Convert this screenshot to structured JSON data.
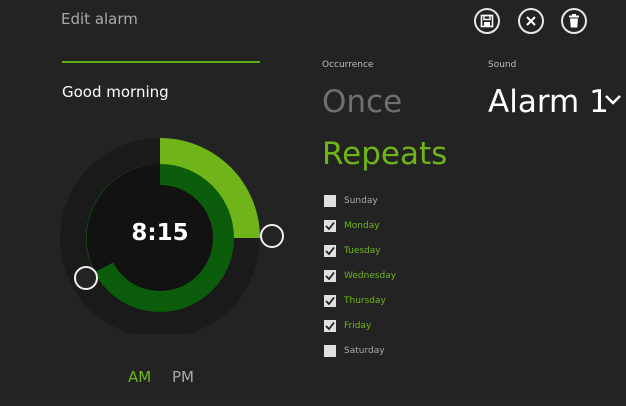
{
  "header": {
    "title": "Edit alarm"
  },
  "alarm": {
    "name": "Good morning",
    "time": "8:15",
    "am": "AM",
    "pm": "PM"
  },
  "occurrence": {
    "label": "Occurrence",
    "once": "Once",
    "repeats": "Repeats"
  },
  "sound": {
    "label": "Sound",
    "value": "Alarm 1"
  },
  "days": [
    {
      "label": "Sunday",
      "checked": false
    },
    {
      "label": "Monday",
      "checked": true
    },
    {
      "label": "Tuesday",
      "checked": true
    },
    {
      "label": "Wednesday",
      "checked": true
    },
    {
      "label": "Thursday",
      "checked": true
    },
    {
      "label": "Friday",
      "checked": true
    },
    {
      "label": "Saturday",
      "checked": false
    }
  ],
  "colors": {
    "accent": "#6fb51a",
    "dark_green": "#0b5c0b",
    "bg": "#232323"
  },
  "icons": {
    "save": "save-icon",
    "cancel": "close-icon",
    "delete": "trash-icon"
  }
}
